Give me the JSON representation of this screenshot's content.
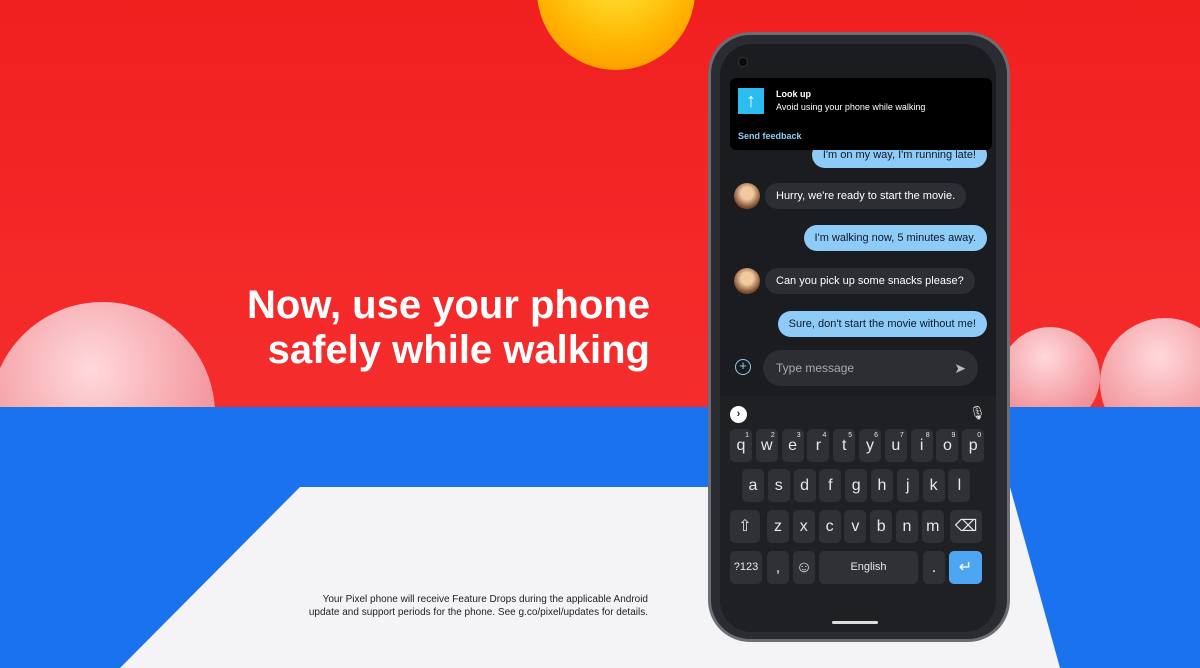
{
  "headline": [
    "Now, use your phone",
    "safely while walking"
  ],
  "disclaimer": [
    "Your Pixel phone will receive Feature Drops during the applicable Android",
    "update and support periods for the phone. See g.co/pixel/updates for details."
  ],
  "notification": {
    "icon": "arrow-up-icon",
    "title": "Look up",
    "body": "Avoid using your phone while walking",
    "action": "Send feedback"
  },
  "messages": [
    {
      "from": "me",
      "text": "I'm on my way, I'm running late!"
    },
    {
      "from": "them",
      "text": "Hurry, we're ready to start the movie."
    },
    {
      "from": "me",
      "text": "I'm walking now, 5 minutes away."
    },
    {
      "from": "them",
      "text": "Can you pick up some snacks please?"
    },
    {
      "from": "me",
      "text": "Sure, don't start the movie without me!"
    }
  ],
  "composer": {
    "placeholder": "Type message"
  },
  "keyboard": {
    "row1": [
      "q",
      "w",
      "e",
      "r",
      "t",
      "y",
      "u",
      "i",
      "o",
      "p"
    ],
    "row1_hints": [
      "1",
      "2",
      "3",
      "4",
      "5",
      "6",
      "7",
      "8",
      "9",
      "0"
    ],
    "row2": [
      "a",
      "s",
      "d",
      "f",
      "g",
      "h",
      "j",
      "k",
      "l"
    ],
    "row3": [
      "z",
      "x",
      "c",
      "v",
      "b",
      "n",
      "m"
    ],
    "symbols": "?123",
    "comma": ",",
    "space": "English",
    "period": "."
  },
  "colors": {
    "accent": "#8ecbf6",
    "enter": "#4ea5f2",
    "red": "#f0201f",
    "blue": "#1a72ee"
  }
}
